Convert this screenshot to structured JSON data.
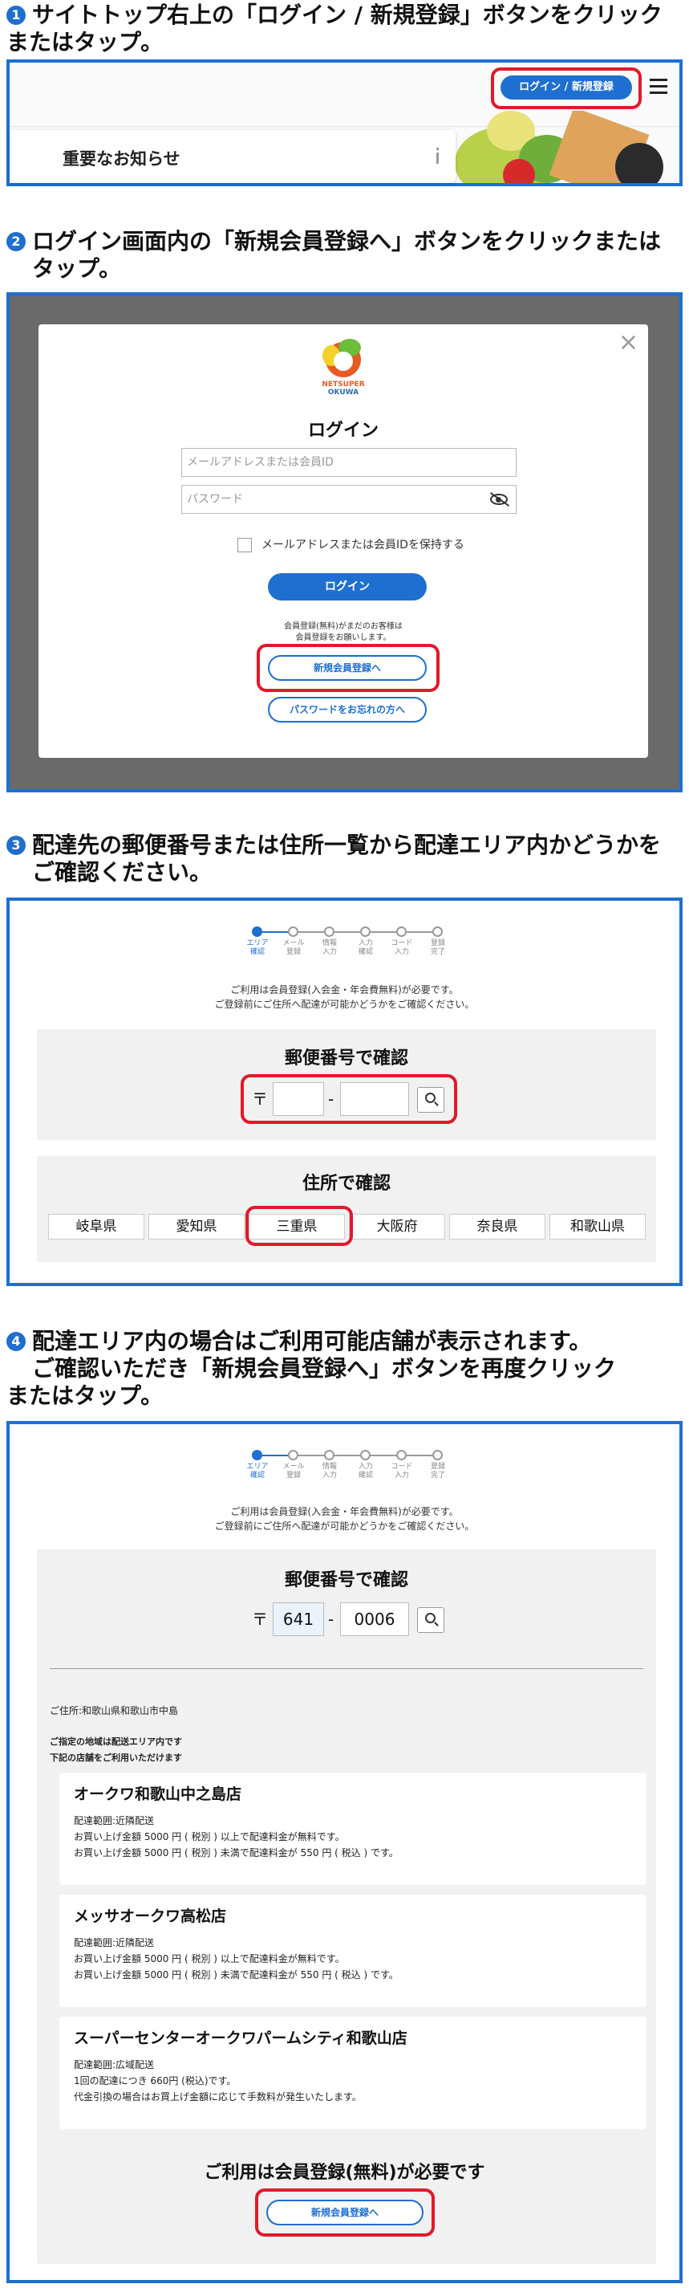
{
  "step1": {
    "num": "1",
    "title_line1": "サイトトップ右上の「ログイン / 新規登録」ボタンをクリック",
    "title_line2": "またはタップ。",
    "login_button": "ログイン / 新規登録",
    "notice": "重要なお知らせ",
    "menu_icon": "hamburger-icon",
    "info_icon": "info-icon"
  },
  "step2": {
    "num": "2",
    "title_line1": "ログイン画面内の「新規会員登録へ」ボタンをクリックまたは",
    "title_line2": "タップ。",
    "logo_text_line1": "NETSUPER",
    "logo_text_line2": "OKUWA",
    "heading": "ログイン",
    "email_placeholder": "メールアドレスまたは会員ID",
    "password_placeholder": "パスワード",
    "remember_label": "メールアドレスまたは会員IDを保持する",
    "login_button": "ログイン",
    "register_note_line1": "会員登録(無料)がまだのお客様は",
    "register_note_line2": "会員登録をお願いします。",
    "register_button": "新規会員登録へ",
    "forgot_button": "パスワードをお忘れの方へ",
    "close_icon": "close-icon",
    "eye_icon": "eye-off-icon"
  },
  "progress": [
    {
      "l1": "エリア",
      "l2": "確認"
    },
    {
      "l1": "メール",
      "l2": "登録"
    },
    {
      "l1": "情報",
      "l2": "入力"
    },
    {
      "l1": "入力",
      "l2": "確認"
    },
    {
      "l1": "コード",
      "l2": "入力"
    },
    {
      "l1": "登録",
      "l2": "完了"
    }
  ],
  "step3": {
    "num": "3",
    "title_line1": "配達先の郵便番号または住所一覧から配達エリア内かどうかを",
    "title_line2": "ご確認ください。",
    "note_line1": "ご利用は会員登録(入会金・年会費無料)が必要です。",
    "note_line2": "ご登録前にご住所へ配達が可能かどうかをご確認ください。",
    "postal_heading": "郵便番号で確認",
    "postal_mark": "〒",
    "dash": "-",
    "address_heading": "住所で確認",
    "prefectures": [
      "岐阜県",
      "愛知県",
      "三重県",
      "大阪府",
      "奈良県",
      "和歌山県"
    ]
  },
  "step4": {
    "num": "4",
    "title_line1": "配達エリア内の場合はご利用可能店舗が表示されます。",
    "title_line2": "ご確認いただき「新規会員登録へ」ボタンを再度クリック",
    "title_line3": "またはタップ。",
    "note_line1": "ご利用は会員登録(入会金・年会費無料)が必要です。",
    "note_line2": "ご登録前にご住所へ配達が可能かどうかをご確認ください。",
    "postal_heading": "郵便番号で確認",
    "postal_mark": "〒",
    "postal1": "641",
    "dash": "-",
    "postal2": "0006",
    "address": "ご住所:和歌山県和歌山市中島",
    "area_line1": "ご指定の地域は配送エリア内です",
    "area_line2": "下記の店舗をご利用いただけます",
    "stores": [
      {
        "name": "オークワ和歌山中之島店",
        "range": "配達範囲:近隣配送",
        "l1": "お買い上げ金額 5000 円 ( 税別 ) 以上で配達料金が無料です。",
        "l2": "お買い上げ金額 5000 円 ( 税別 ) 未満で配達料金が 550 円 ( 税込 ) です。"
      },
      {
        "name": "メッサオークワ高松店",
        "range": "配達範囲:近隣配送",
        "l1": "お買い上げ金額 5000 円 ( 税別 ) 以上で配達料金が無料です。",
        "l2": "お買い上げ金額 5000 円 ( 税別 ) 未満で配達料金が 550 円 ( 税込 ) です。"
      },
      {
        "name": "スーパーセンターオークワパームシティ和歌山店",
        "range": "配達範囲:広域配送",
        "l1": "1回の配達につき 660円 (税込)です。",
        "l2": "代金引換の場合はお買上げ金額に応じて手数料が発生いたします。"
      }
    ],
    "register_required": "ご利用は会員登録(無料)が必要です",
    "register_button": "新規会員登録へ"
  }
}
